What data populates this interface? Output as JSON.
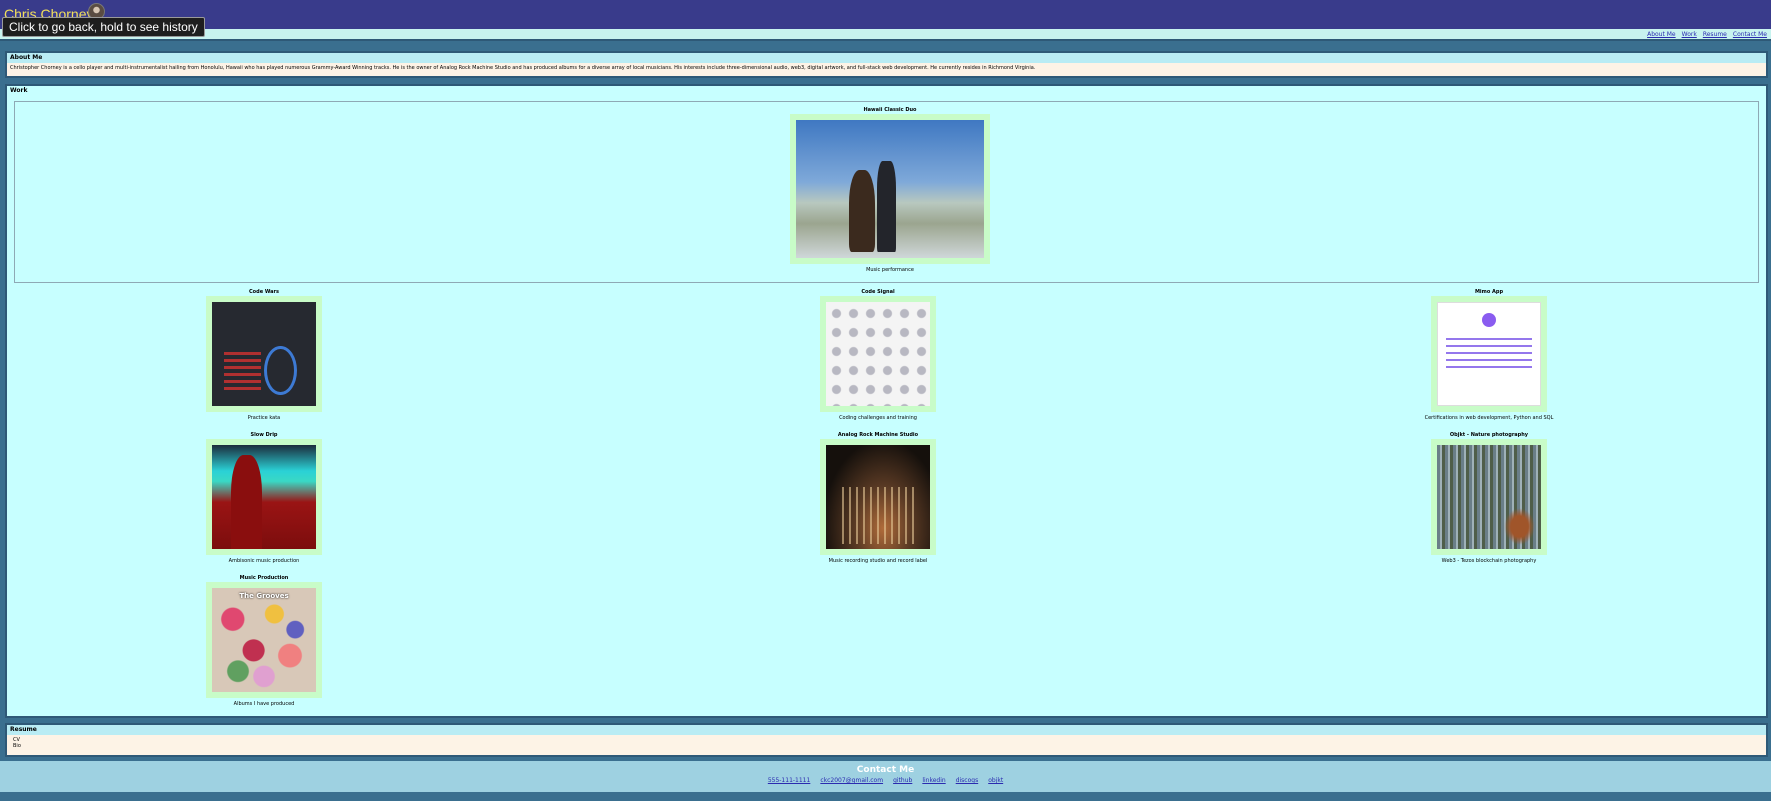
{
  "header": {
    "site_title": "Chris Chorney",
    "back_tooltip": "Click to go back, hold to see history"
  },
  "nav": {
    "items": [
      "About Me",
      "Work",
      "Resume",
      "Contact Me"
    ]
  },
  "about": {
    "heading": "About Me",
    "text": "Christopher Chorney is a cello player and multi-instrumentalist hailing from Honolulu, Hawaii who has played numerous Grammy-Award Winning tracks. He is the owner of Analog Rock Machine Studio and has produced albums for a diverse array of local musicians. His interests include three-dimensional audio, web3, digital artwork, and full-stack web development. He currently resides in Richmond Virginia."
  },
  "work": {
    "heading": "Work",
    "featured": {
      "title": "Hawaii Classic Duo",
      "desc": "Music performance",
      "image": "duo-photo"
    },
    "items": [
      {
        "title": "Code Wars",
        "desc": "Practice kata",
        "image": "codewars-screenshot"
      },
      {
        "title": "Code Signal",
        "desc": "Coding challenges and training",
        "image": "codesignal-badges"
      },
      {
        "title": "Mimo App",
        "desc": "Certifications in web development, Python and SQL",
        "image": "mimo-certificate"
      },
      {
        "title": "Slow Drip",
        "desc": "Ambisonic music production",
        "image": "slowdrip-art"
      },
      {
        "title": "Analog Rock Machine Studio",
        "desc": "Music recording studio and record label",
        "image": "studio-mixer"
      },
      {
        "title": "Objkt - Nature photography",
        "desc": "Web3 - Tezos blockchain photography",
        "image": "nature-photo"
      },
      {
        "title": "Music Production",
        "desc": "Albums I have produced",
        "image": "album-cover",
        "image_text": "The Grooves"
      }
    ]
  },
  "resume": {
    "heading": "Resume",
    "items": [
      "CV",
      "Bio"
    ]
  },
  "contact": {
    "heading": "Contact Me",
    "links": [
      "555-111-1111",
      "ckc2007@gmail.com",
      "github",
      "linkedin",
      "discogs",
      "objkt"
    ]
  },
  "colors": {
    "header_bg": "#393b8b",
    "title_color": "#f2e05a",
    "work_bg": "#c7ffff",
    "thumb_border": "#c8fcc8",
    "link_color": "#2b2bb0"
  }
}
